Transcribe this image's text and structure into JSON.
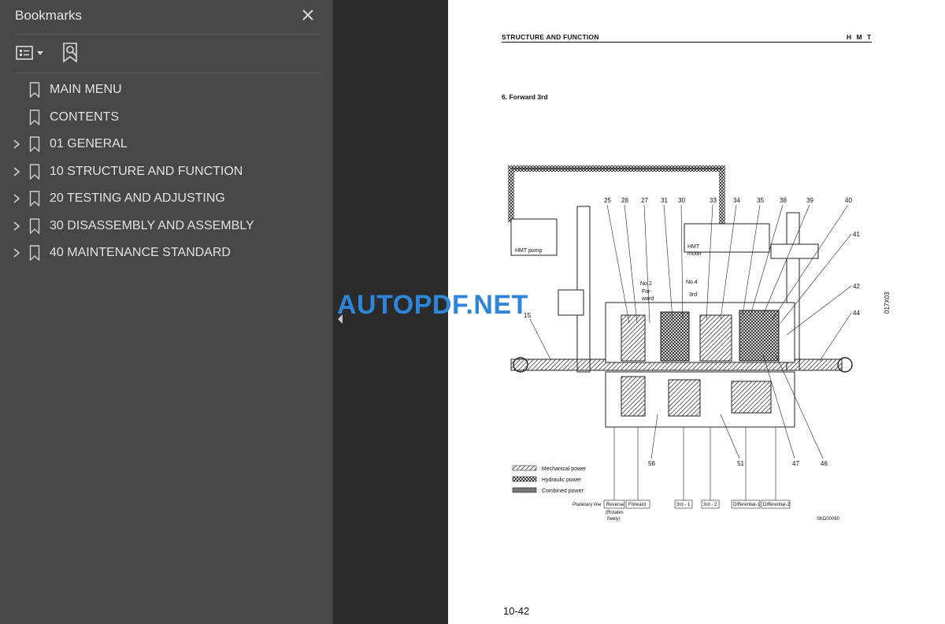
{
  "sidebar": {
    "title": "Bookmarks",
    "items": [
      {
        "label": "MAIN MENU",
        "expandable": false
      },
      {
        "label": "CONTENTS",
        "expandable": false
      },
      {
        "label": "01 GENERAL",
        "expandable": true
      },
      {
        "label": "10 STRUCTURE AND FUNCTION",
        "expandable": true
      },
      {
        "label": "20 TESTING AND ADJUSTING",
        "expandable": true
      },
      {
        "label": "30 DISASSEMBLY AND ASSEMBLY",
        "expandable": true
      },
      {
        "label": "40 MAINTENANCE STANDARD",
        "expandable": true
      }
    ]
  },
  "page": {
    "header_left": "STRUCTURE AND FUNCTION",
    "header_right": "H M T",
    "section_title": "6.   Forward 3rd",
    "side_code": "017X03",
    "page_number": "10-42",
    "diagram": {
      "hmt_pump": "HMT pump",
      "hmt_motor_1": "HMT",
      "hmt_motor_2": "motor",
      "callouts_top": [
        "25",
        "28",
        "27",
        "31",
        "30",
        "33",
        "34",
        "35",
        "38",
        "39",
        "40"
      ],
      "callouts_right": [
        "41",
        "42",
        "44"
      ],
      "callout_left": "15",
      "callouts_bottom": [
        "56",
        "51",
        "47",
        "46"
      ],
      "no2": "No.2",
      "forward_1": "For-",
      "forward_2": "ward",
      "no4": "No.4",
      "third": "3rd",
      "legend": [
        ": Mechanical power",
        ": Hydraulic power",
        ": Combined power"
      ],
      "planetary_line": "Planetary line",
      "planetary_boxes": [
        "Reverse",
        "Forward",
        "3rd - 1",
        "3rd - 2",
        "Differential-1",
        "Differential-2"
      ],
      "rotates_1": "(Rotates",
      "rotates_2": "freely)",
      "code": "SKD00060"
    }
  },
  "watermark": "AUTOPDF.NET"
}
